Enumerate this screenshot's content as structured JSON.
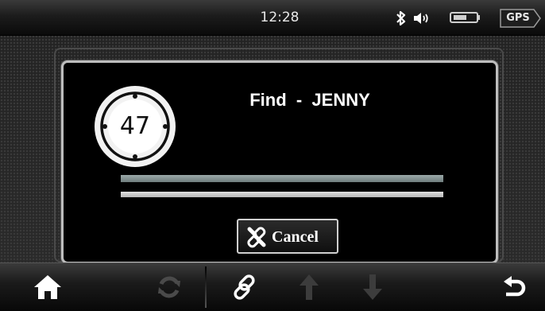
{
  "status_bar": {
    "time": "12:28",
    "bluetooth_icon": "bluetooth-icon",
    "volume_icon": "speaker-icon",
    "battery_icon": "battery-icon",
    "gps_label": "GPS"
  },
  "dialog": {
    "compass_number": "47",
    "title": "Find  -  JENNY",
    "cancel_label": "Cancel",
    "cancel_icon": "broken-link-icon"
  },
  "toolbar": {
    "items": [
      {
        "icon": "home-icon",
        "enabled": true
      },
      {
        "icon": "refresh-icon",
        "enabled": false
      },
      {
        "icon": "link-icon",
        "enabled": true
      },
      {
        "icon": "arrow-up-icon",
        "enabled": false
      },
      {
        "icon": "arrow-down-icon",
        "enabled": false
      },
      {
        "icon": "back-icon",
        "enabled": true
      }
    ]
  },
  "colors": {
    "dialog_border": "#bdbdbd",
    "text": "#ffffff",
    "progress_top": "#8a9898",
    "progress_bottom": "#d6d6d6"
  }
}
